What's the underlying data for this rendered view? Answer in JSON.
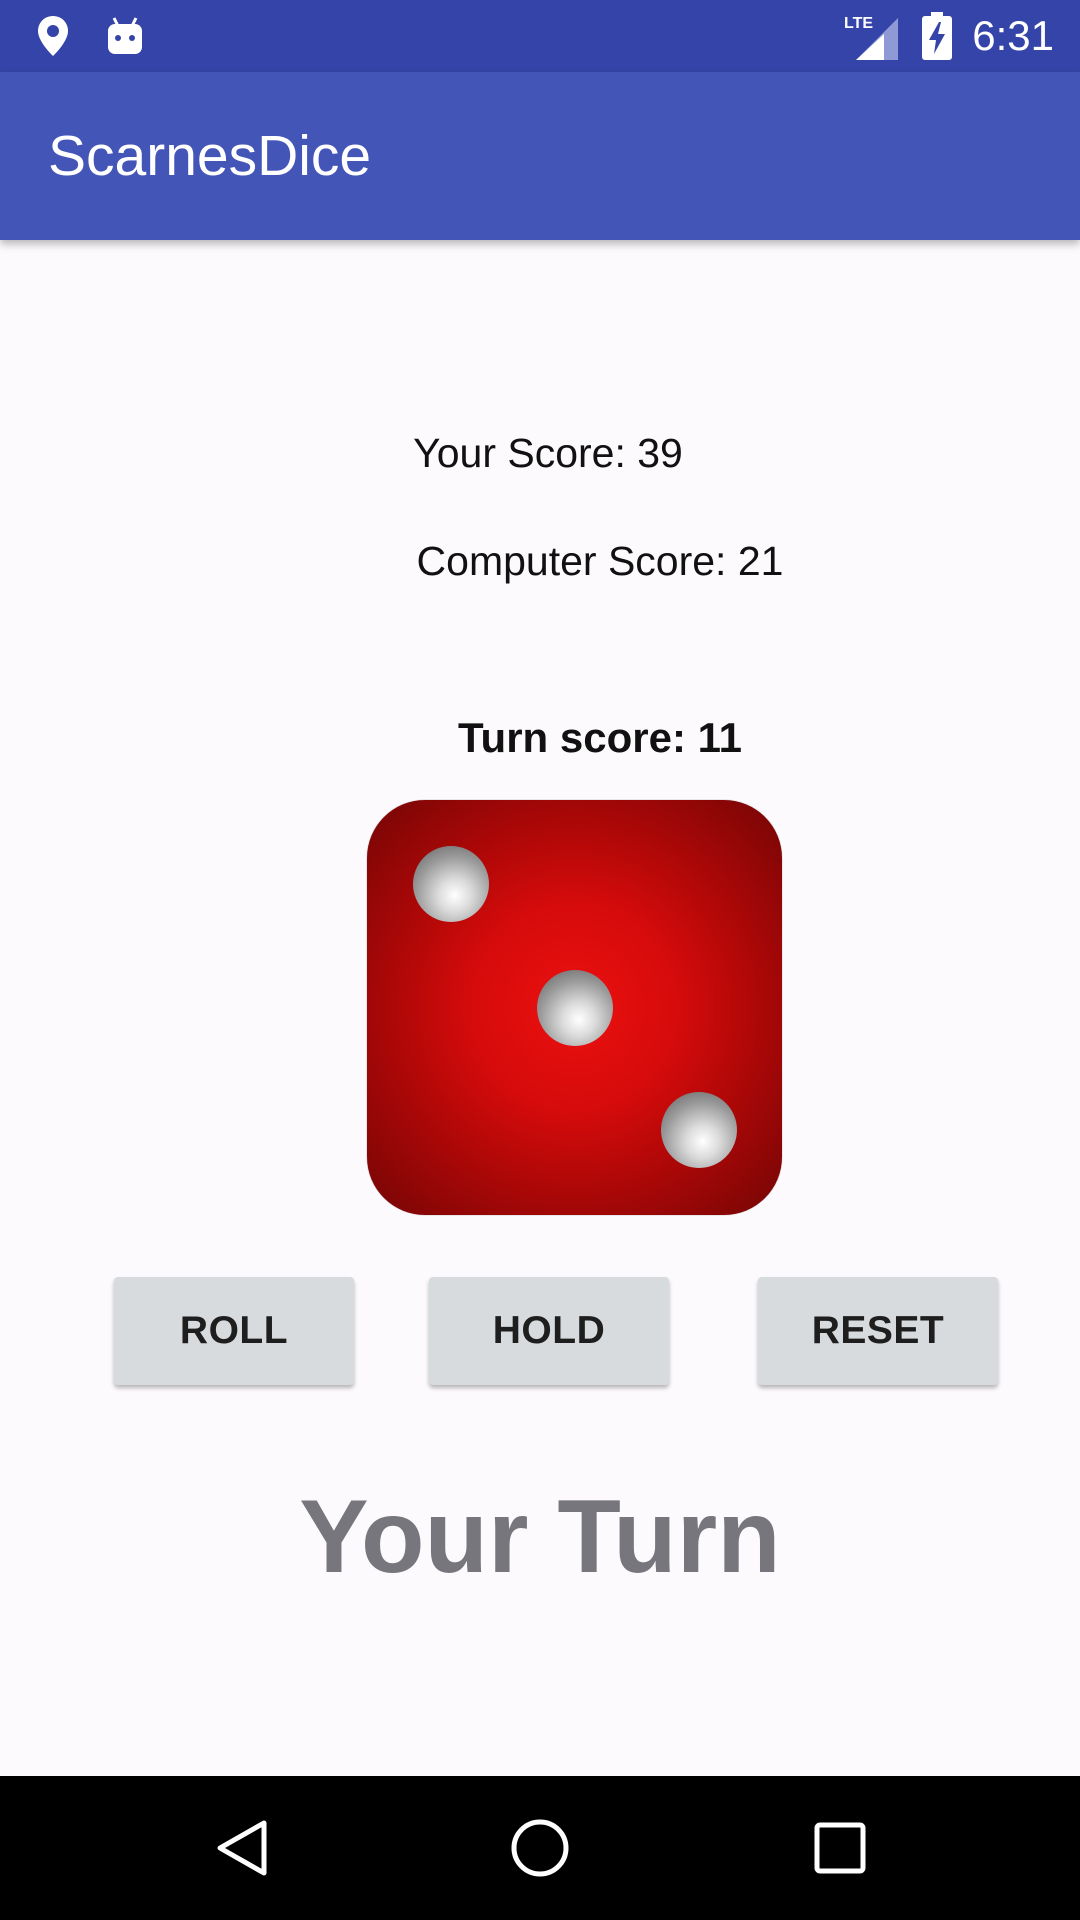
{
  "status_bar": {
    "time": "6:31",
    "network_label": "LTE",
    "icons": [
      "location-pin-icon",
      "android-debug-icon",
      "lte-signal-icon",
      "battery-charging-icon"
    ]
  },
  "app_bar": {
    "title": "ScarnesDice"
  },
  "scores": {
    "your_score": "Your Score: 39",
    "computer_score": "Computer Score: 21",
    "turn_score": "Turn score: 11"
  },
  "die": {
    "value": 3,
    "color": "#d60b0b"
  },
  "buttons": {
    "roll": "ROLL",
    "hold": "HOLD",
    "reset": "RESET"
  },
  "status_message": "Your Turn",
  "nav_bar": {
    "icons": [
      "back-icon",
      "home-icon",
      "recents-icon"
    ]
  },
  "colors": {
    "status_bar": "#3544a8",
    "app_bar": "#4455b8",
    "button_bg": "#d7dbdd",
    "status_message": "#76767c"
  }
}
